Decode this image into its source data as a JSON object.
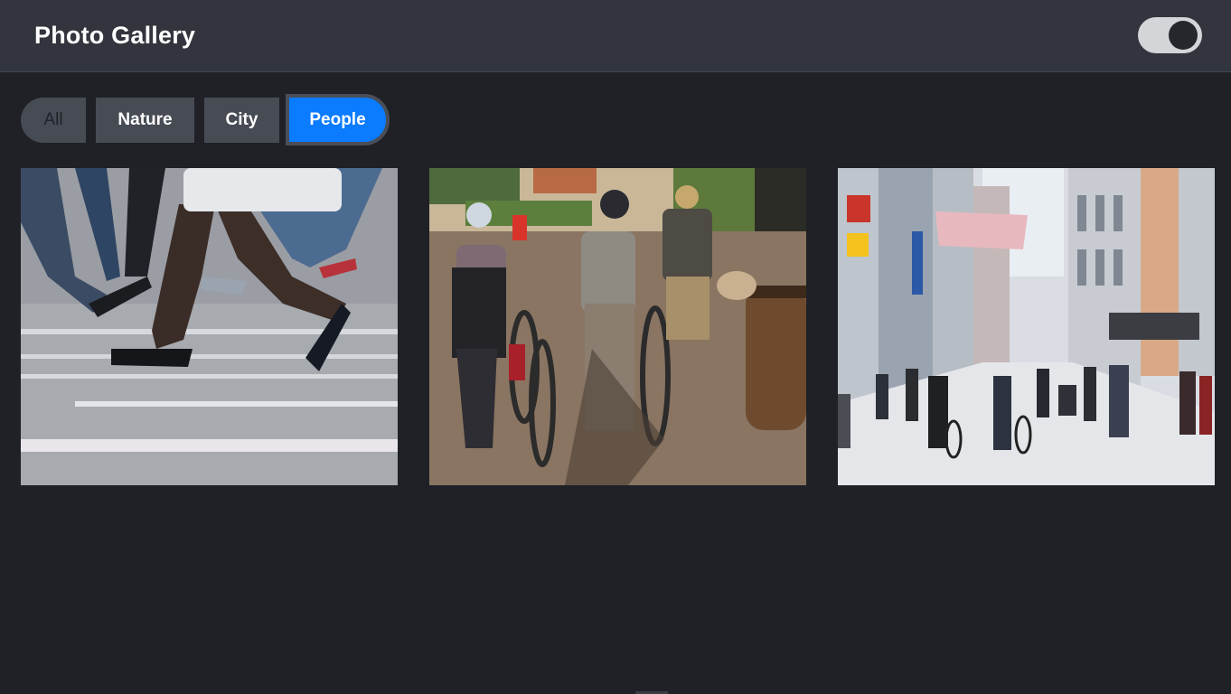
{
  "header": {
    "title": "Photo Gallery",
    "theme_toggle": {
      "state": "dark"
    }
  },
  "filters": [
    {
      "label": "All",
      "active": false
    },
    {
      "label": "Nature",
      "active": false
    },
    {
      "label": "City",
      "active": false
    },
    {
      "label": "People",
      "active": true
    }
  ],
  "gallery": [
    {
      "subject": "pedestrians-crosswalk",
      "category": "People"
    },
    {
      "subject": "cyclists-walking-bikes",
      "category": "People"
    },
    {
      "subject": "shopping-street-crowd",
      "category": "People"
    }
  ],
  "colors": {
    "accent": "#0b7bff",
    "background": "#1f2126",
    "header": "#32353d"
  }
}
